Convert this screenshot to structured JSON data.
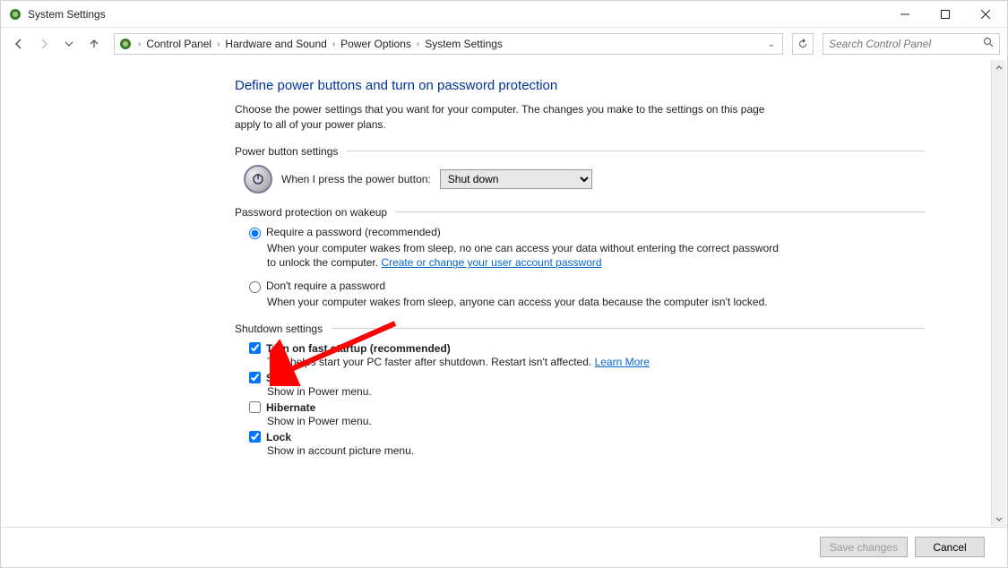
{
  "window": {
    "title": "System Settings"
  },
  "breadcrumb": {
    "items": [
      "Control Panel",
      "Hardware and Sound",
      "Power Options",
      "System Settings"
    ]
  },
  "search": {
    "placeholder": "Search Control Panel"
  },
  "page": {
    "heading": "Define power buttons and turn on password protection",
    "intro": "Choose the power settings that you want for your computer. The changes you make to the settings on this page apply to all of your power plans."
  },
  "sections": {
    "power_button": {
      "title": "Power button settings",
      "label": "When I press the power button:",
      "selected": "Shut down"
    },
    "password": {
      "title": "Password protection on wakeup",
      "opt1_label": "Require a password (recommended)",
      "opt1_desc_a": "When your computer wakes from sleep, no one can access your data without entering the correct password to unlock the computer. ",
      "opt1_link": "Create or change your user account password",
      "opt2_label": "Don't require a password",
      "opt2_desc": "When your computer wakes from sleep, anyone can access your data because the computer isn't locked."
    },
    "shutdown": {
      "title": "Shutdown settings",
      "fast_startup_label": "Turn on fast startup (recommended)",
      "fast_startup_desc": "This helps start your PC faster after shutdown. Restart isn't affected. ",
      "fast_startup_link": "Learn More",
      "sleep_label": "Sleep",
      "sleep_desc": "Show in Power menu.",
      "hibernate_label": "Hibernate",
      "hibernate_desc": "Show in Power menu.",
      "lock_label": "Lock",
      "lock_desc": "Show in account picture menu."
    }
  },
  "footer": {
    "save": "Save changes",
    "cancel": "Cancel"
  }
}
